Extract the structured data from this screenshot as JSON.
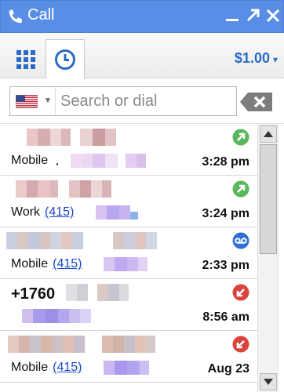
{
  "window": {
    "title": "Call",
    "controls": {
      "minimize": "minimize-icon",
      "popout": "popout-icon",
      "close": "close-icon"
    }
  },
  "toolbar": {
    "tabs": [
      {
        "name": "dialpad",
        "icon": "dialpad-icon"
      },
      {
        "name": "history",
        "icon": "clock-icon",
        "selected": true
      }
    ],
    "balance": "$1.00",
    "balance_caret": "▾"
  },
  "search": {
    "country": "United States",
    "country_icon": "us-flag-icon",
    "placeholder": "Search or dial",
    "value": "",
    "clear_icon": "backspace-icon"
  },
  "calls": [
    {
      "label": "Mobile",
      "number": "",
      "time": "3:28 pm",
      "status": "outgoing",
      "status_color": "#5cb85c"
    },
    {
      "label": "Work",
      "number": "(415)",
      "time": "3:24 pm",
      "status": "outgoing",
      "status_color": "#5cb85c"
    },
    {
      "label": "Mobile",
      "number": "(415)",
      "time": "2:33 pm",
      "status": "voicemail",
      "status_color": "#2f6fd6"
    },
    {
      "label": "",
      "number": "+1760",
      "time": "8:56 am",
      "status": "missed",
      "status_color": "#d9453d"
    },
    {
      "label": "Mobile",
      "number": "(415)",
      "time": "Aug 23",
      "status": "missed",
      "status_color": "#d9453d"
    }
  ],
  "colors": {
    "titlebar": "#5a8ee6",
    "accent": "#2a6bc6",
    "link": "#1a47c9"
  }
}
